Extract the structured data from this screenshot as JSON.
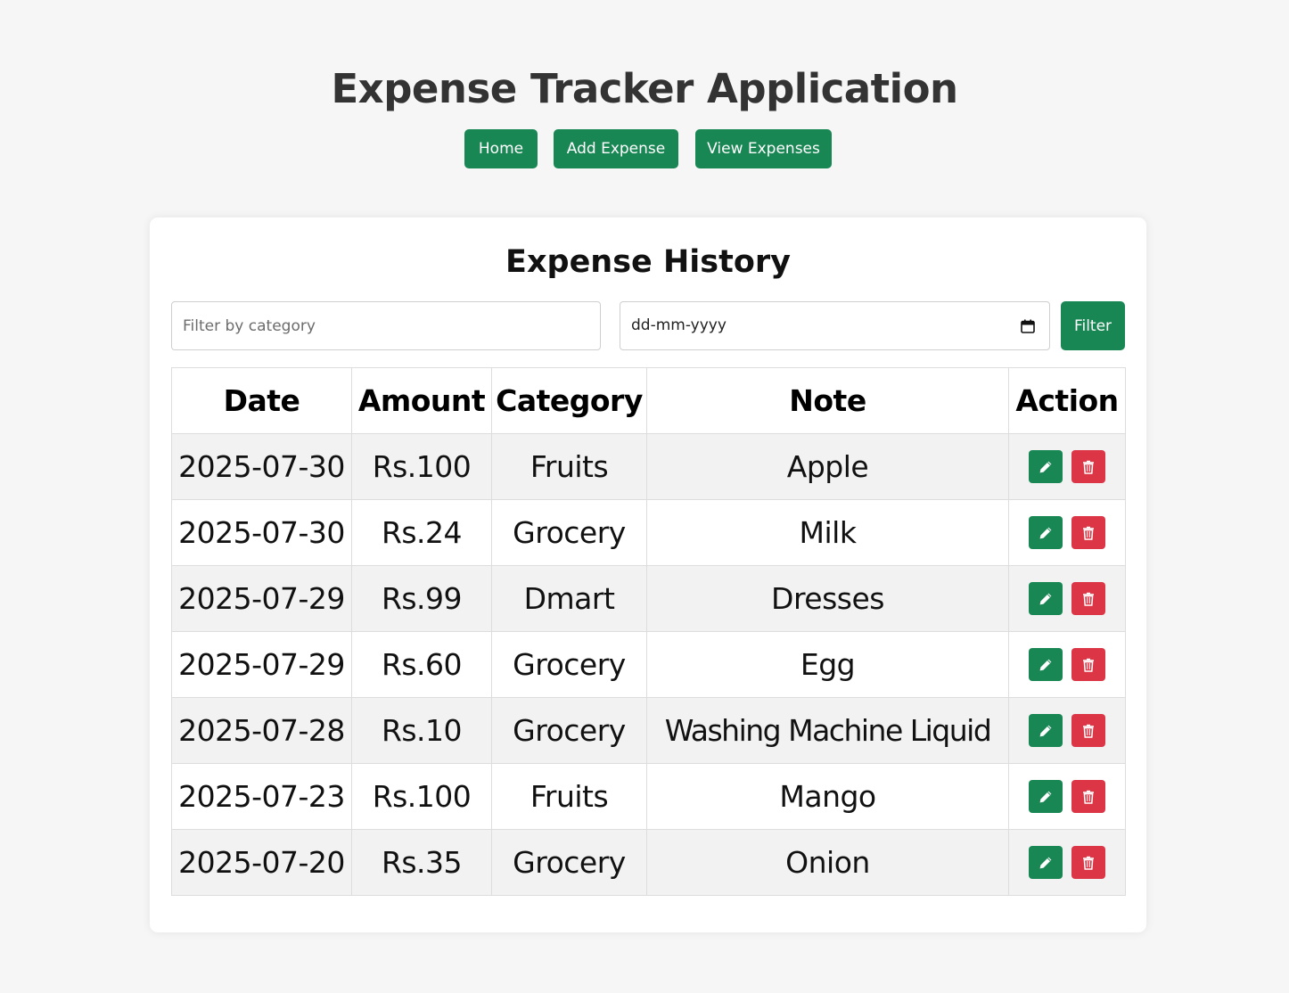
{
  "app": {
    "title": "Expense Tracker Application"
  },
  "nav": {
    "items": [
      {
        "label": "Home"
      },
      {
        "label": "Add Expense"
      },
      {
        "label": "View Expenses"
      }
    ]
  },
  "history": {
    "title": "Expense History",
    "filter": {
      "category_placeholder": "Filter by category",
      "category_value": "",
      "date_placeholder": "dd-mm-yyyy",
      "button_label": "Filter"
    },
    "table": {
      "headers": [
        "Date",
        "Amount",
        "Category",
        "Note",
        "Action"
      ],
      "rows": [
        {
          "date": "2025-07-30",
          "amount": "Rs.100",
          "category": "Fruits",
          "note": "Apple"
        },
        {
          "date": "2025-07-30",
          "amount": "Rs.24",
          "category": "Grocery",
          "note": "Milk"
        },
        {
          "date": "2025-07-29",
          "amount": "Rs.99",
          "category": "Dmart",
          "note": "Dresses"
        },
        {
          "date": "2025-07-29",
          "amount": "Rs.60",
          "category": "Grocery",
          "note": "Egg"
        },
        {
          "date": "2025-07-28",
          "amount": "Rs.10",
          "category": "Grocery",
          "note": "Washing Machine Liquid"
        },
        {
          "date": "2025-07-23",
          "amount": "Rs.100",
          "category": "Fruits",
          "note": "Mango"
        },
        {
          "date": "2025-07-20",
          "amount": "Rs.35",
          "category": "Grocery",
          "note": "Onion"
        }
      ],
      "row_actions": [
        {
          "icon": "pencil-icon",
          "color": "#198754"
        },
        {
          "icon": "trash-icon",
          "color": "#dc3545"
        }
      ]
    }
  },
  "colors": {
    "primary": "#198754",
    "danger": "#dc3545",
    "background": "#f6f6f6",
    "stripe": "#f2f2f2"
  }
}
